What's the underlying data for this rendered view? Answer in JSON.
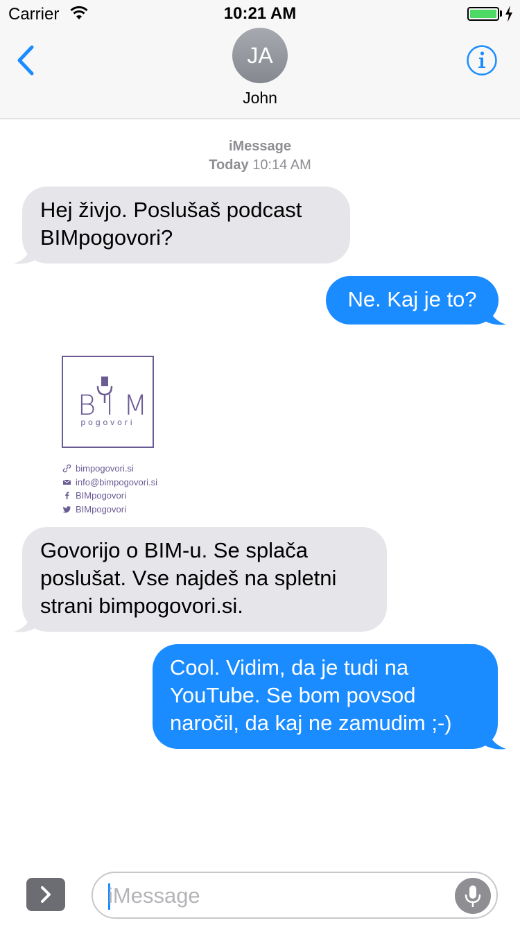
{
  "status_bar": {
    "carrier": "Carrier",
    "time": "10:21 AM",
    "battery_level": 1.0
  },
  "header": {
    "avatar_initials": "JA",
    "contact_name": "John",
    "back_icon": "chevron-left-icon",
    "info_icon": "info-icon"
  },
  "thread_meta": {
    "service": "iMessage",
    "day": "Today",
    "time": "10:14 AM"
  },
  "messages": [
    {
      "direction": "incoming",
      "lines": [
        "Hej živjo. Poslušaš podcast",
        "BIMpogovori?"
      ]
    },
    {
      "direction": "outgoing",
      "lines": [
        "Ne. Kaj je to?"
      ]
    },
    {
      "direction": "incoming",
      "type": "image"
    },
    {
      "direction": "incoming",
      "lines": [
        "Govorijo o BIM-u. Se splača",
        "poslušat. Vse najdeš na spletni",
        "strani bimpogovori.si."
      ]
    },
    {
      "direction": "outgoing",
      "lines": [
        "Cool. Vidim, da je tudi na",
        "YouTube. Se bom povsod",
        "naročil, da kaj ne zamudim ;-)"
      ]
    }
  ],
  "image_card": {
    "logo_text": "BIM",
    "logo_subtitle": "pogovori",
    "links": [
      {
        "icon": "link-icon",
        "text": "bimpogovori.si"
      },
      {
        "icon": "mail-icon",
        "text": "info@bimpogovori.si"
      },
      {
        "icon": "facebook-icon",
        "text": "BIMpogovori"
      },
      {
        "icon": "twitter-icon",
        "text": "BIMpogovori"
      }
    ]
  },
  "composer": {
    "placeholder": "iMessage",
    "value": ""
  },
  "colors": {
    "incoming_bubble": "#e5e5ea",
    "outgoing_bubble": "#1a8cff",
    "accent": "#1a8cff",
    "logo": "#6b5b95"
  }
}
